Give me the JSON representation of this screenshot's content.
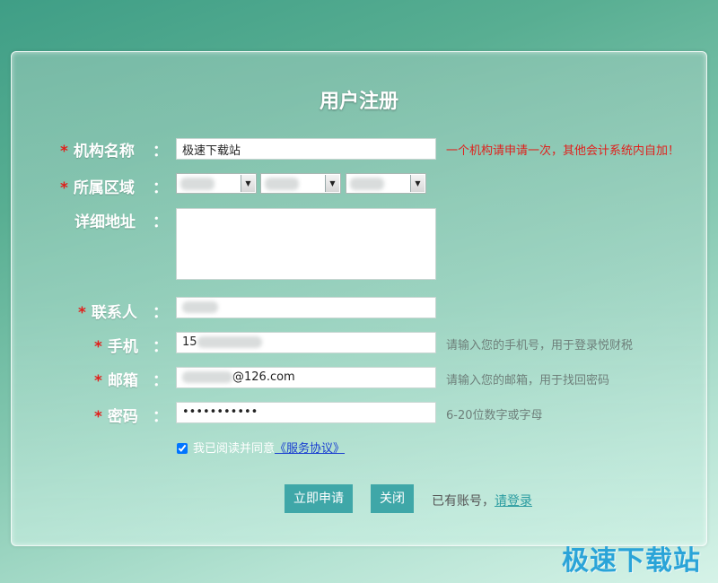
{
  "page": {
    "title": "用户注册"
  },
  "form": {
    "org_name": {
      "label": "机构名称",
      "value": "极速下载站",
      "warning": "一个机构请申请一次，其他会计系统内自加！"
    },
    "region": {
      "label": "所属区域"
    },
    "address": {
      "label": "详细地址",
      "value": ""
    },
    "contact": {
      "label": "联系人"
    },
    "phone": {
      "label": "手机",
      "value_prefix": "15",
      "hint": "请输入您的手机号，用于登录悦财税"
    },
    "email": {
      "label": "邮箱",
      "value_suffix": "@126.com",
      "hint": "请输入您的邮箱，用于找回密码"
    },
    "password": {
      "label": "密码",
      "value": "•••••••••••",
      "hint": "6-20位数字或字母"
    },
    "required_mark": "*",
    "colon": "："
  },
  "agreement": {
    "text": "我已阅读并同意",
    "link": "《服务协议》",
    "checked": true
  },
  "actions": {
    "submit_label": "立即申请",
    "close_label": "关闭",
    "have_account": "已有账号，",
    "login_link": "请登录"
  },
  "watermark": "极速下载站",
  "colors": {
    "accent": "#3fa7a8",
    "required": "#e0201c",
    "link": "#1a3fd0"
  }
}
